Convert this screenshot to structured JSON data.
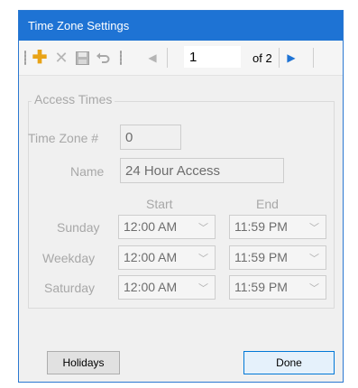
{
  "window": {
    "title": "Time Zone Settings"
  },
  "toolbar": {
    "icons": [
      "add-icon",
      "delete-icon",
      "save-icon",
      "undo-icon",
      "prev-record-icon",
      "next-record-icon"
    ],
    "position_value": "1",
    "of_label": "of 2"
  },
  "group": {
    "title": "Access Times"
  },
  "form": {
    "timezone_label": "Time Zone #",
    "timezone_value": "0",
    "name_label": "Name",
    "name_value": "24 Hour Access",
    "start_header": "Start",
    "end_header": "End",
    "rows": [
      {
        "label": "Sunday",
        "start": "12:00 AM",
        "end": "11:59 PM"
      },
      {
        "label": "Weekday",
        "start": "12:00 AM",
        "end": "11:59 PM"
      },
      {
        "label": "Saturday",
        "start": "12:00 AM",
        "end": "11:59 PM"
      }
    ]
  },
  "buttons": {
    "holidays": "Holidays",
    "done": "Done"
  },
  "colors": {
    "title_bar": "#1e73d4",
    "add_icon": "#e8a317",
    "nav_arrow": "#1e73d4"
  }
}
